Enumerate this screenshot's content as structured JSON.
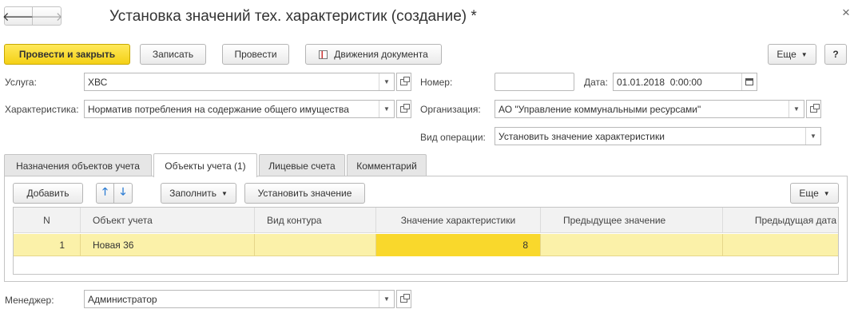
{
  "window": {
    "title": "Установка значений тех. характеристик (создание) *",
    "close_glyph": "×"
  },
  "toolbar": {
    "post_close_label": "Провести и закрыть",
    "save_label": "Записать",
    "post_label": "Провести",
    "movements_label": "Движения документа",
    "more_label": "Еще",
    "help_label": "?"
  },
  "form": {
    "service_label": "Услуга:",
    "service_value": "ХВС",
    "characteristic_label": "Характеристика:",
    "characteristic_value": "Норматив потребления на содержание общего имущества",
    "number_label": "Номер:",
    "number_value": "",
    "date_label": "Дата:",
    "date_value": "01.01.2018  0:00:00",
    "org_label": "Организация:",
    "org_value": "АО \"Управление коммунальными ресурсами\"",
    "op_type_label": "Вид операции:",
    "op_type_value": "Установить значение характеристики",
    "manager_label": "Менеджер:",
    "manager_value": "Администратор"
  },
  "tabs": [
    {
      "label": "Назначения объектов учета",
      "active": false
    },
    {
      "label": "Объекты учета (1)",
      "active": true
    },
    {
      "label": "Лицевые счета",
      "active": false
    },
    {
      "label": "Комментарий",
      "active": false
    }
  ],
  "tab_toolbar": {
    "add_label": "Добавить",
    "fill_label": "Заполнить",
    "set_value_label": "Установить значение",
    "more_label": "Еще"
  },
  "table": {
    "columns": [
      "N",
      "Объект учета",
      "Вид контура",
      "Значение характеристики",
      "Предыдущее значение",
      "Предыдущая дата"
    ],
    "rows": [
      {
        "n": "1",
        "object": "Новая 36",
        "contour": "",
        "value": "8",
        "prev_value": "",
        "prev_date": ""
      }
    ]
  },
  "colors": {
    "primary_button": "#f4d016",
    "selected_row": "#fbf1a9",
    "selected_cell": "#f9d82c"
  }
}
